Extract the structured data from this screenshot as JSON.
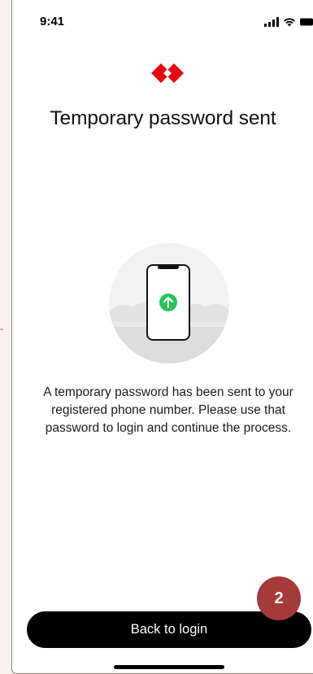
{
  "status_bar": {
    "time": "9:41"
  },
  "icons": {
    "signal": "cellular-signal-icon",
    "wifi": "wifi-icon",
    "battery": "battery-icon",
    "logo": "brand-logo",
    "illustration": "phone-upload-illustration"
  },
  "colors": {
    "brand": "#e30613",
    "button": "#000000",
    "upload_green": "#2ec05a",
    "badge": "#a53a3a"
  },
  "screen": {
    "title": "Temporary password sent",
    "message": "A temporary password has been sent to your registered phone number. Please use that password to login and continue the process."
  },
  "actions": {
    "back_to_login_label": "Back to login"
  },
  "annotation": {
    "step_number": "2"
  }
}
